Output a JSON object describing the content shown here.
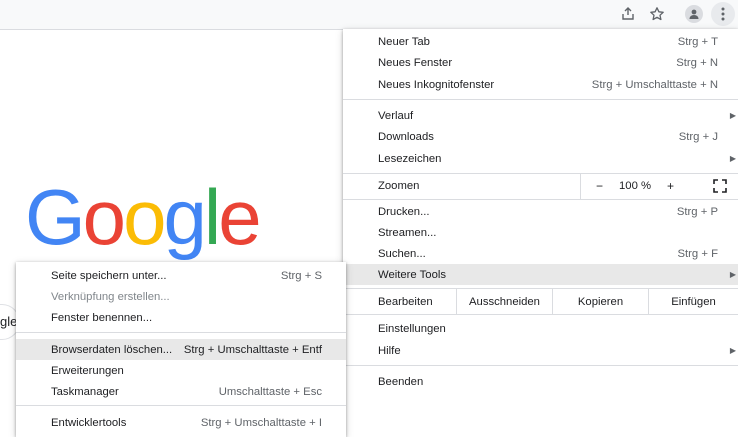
{
  "toolbar": {
    "icons": [
      "share-icon",
      "star-icon",
      "profile-icon",
      "menu-icon"
    ]
  },
  "page": {
    "logo_letters": [
      "G",
      "o",
      "o",
      "g",
      "l",
      "e"
    ],
    "logo_colors": [
      "#4285F4",
      "#EA4335",
      "#FBBC05",
      "#4285F4",
      "#34A853",
      "#EA4335"
    ],
    "search_fragment": "gle"
  },
  "menu": {
    "new_tab": {
      "label": "Neuer Tab",
      "shortcut": "Strg + T"
    },
    "new_window": {
      "label": "Neues Fenster",
      "shortcut": "Strg + N"
    },
    "incognito": {
      "label": "Neues Inkognitofenster",
      "shortcut": "Strg + Umschalttaste + N"
    },
    "history": {
      "label": "Verlauf"
    },
    "downloads": {
      "label": "Downloads",
      "shortcut": "Strg + J"
    },
    "bookmarks": {
      "label": "Lesezeichen"
    },
    "zoom": {
      "label": "Zoomen",
      "minus": "−",
      "value": "100 %",
      "plus": "+"
    },
    "print": {
      "label": "Drucken...",
      "shortcut": "Strg + P"
    },
    "cast": {
      "label": "Streamen..."
    },
    "find": {
      "label": "Suchen...",
      "shortcut": "Strg + F"
    },
    "more_tools": {
      "label": "Weitere Tools"
    },
    "edit": {
      "label": "Bearbeiten",
      "cut": "Ausschneiden",
      "copy": "Kopieren",
      "paste": "Einfügen"
    },
    "settings": {
      "label": "Einstellungen"
    },
    "help": {
      "label": "Hilfe"
    },
    "exit": {
      "label": "Beenden"
    }
  },
  "submenu": {
    "save_page": {
      "label": "Seite speichern unter...",
      "shortcut": "Strg + S"
    },
    "create_shortcut": {
      "label": "Verknüpfung erstellen..."
    },
    "name_window": {
      "label": "Fenster benennen..."
    },
    "clear_data": {
      "label": "Browserdaten löschen...",
      "shortcut": "Strg + Umschalttaste + Entf"
    },
    "extensions": {
      "label": "Erweiterungen"
    },
    "task_manager": {
      "label": "Taskmanager",
      "shortcut": "Umschalttaste + Esc"
    },
    "dev_tools": {
      "label": "Entwicklertools",
      "shortcut": "Strg + Umschalttaste + I"
    }
  },
  "colors": {
    "highlight": "#e8e8e8",
    "separator": "#dadce0",
    "text": "#202124",
    "shortcut_text": "#5f6368"
  }
}
